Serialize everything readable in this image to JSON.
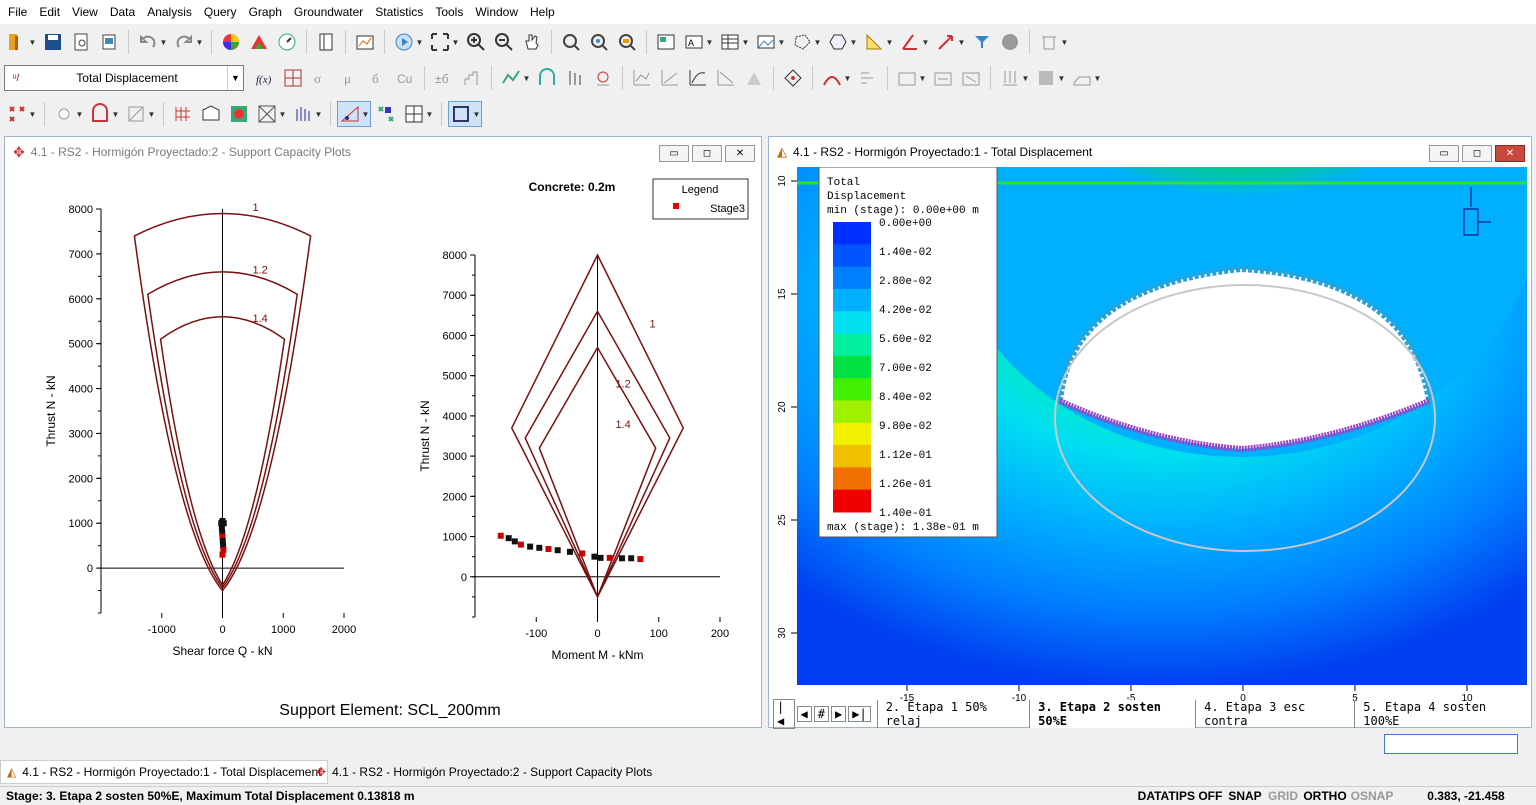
{
  "menu": [
    "File",
    "Edit",
    "View",
    "Data",
    "Analysis",
    "Query",
    "Graph",
    "Groundwater",
    "Statistics",
    "Tools",
    "Window",
    "Help"
  ],
  "toolbar": {
    "contour_selector": "Total Displacement"
  },
  "left_window": {
    "title": "4.1 - RS2 - Hormigón Proyectado:2 - Support Capacity Plots",
    "concrete_label": "Concrete: 0.2m",
    "legend_title": "Legend",
    "legend_item": "Stage3",
    "support_element": "Support Element: SCL_200mm",
    "chart_data": [
      {
        "type": "scatter",
        "xlabel": "Shear force Q - kN",
        "ylabel": "Thrust N - kN",
        "xlim": [
          -2000,
          2000
        ],
        "ylim": [
          -1000,
          8000
        ],
        "x_ticks": [
          "-1000",
          "0",
          "1000",
          "2000"
        ],
        "y_ticks": [
          "8000",
          "7000",
          "6000",
          "5000",
          "4000",
          "3000",
          "2000",
          "1000",
          "0"
        ],
        "envelope_labels": [
          "1",
          "1.2",
          "1.4"
        ],
        "series": [
          {
            "name": "Stage3",
            "x": [
              -15,
              -10,
              -5,
              0,
              5,
              10,
              15,
              -20,
              20,
              0,
              0
            ],
            "y": [
              1000,
              900,
              800,
              700,
              600,
              500,
              400,
              1000,
              1000,
              300,
              1050
            ]
          }
        ]
      },
      {
        "type": "scatter",
        "xlabel": "Moment M - kNm",
        "ylabel": "Thrust N - kN",
        "xlim": [
          -200,
          200
        ],
        "ylim": [
          -1000,
          8000
        ],
        "x_ticks": [
          "-100",
          "0",
          "100",
          "200"
        ],
        "y_ticks": [
          "8000",
          "7000",
          "6000",
          "5000",
          "4000",
          "3000",
          "2000",
          "1000",
          "0"
        ],
        "envelope_labels": [
          "1",
          "1.2",
          "1.4"
        ],
        "series": [
          {
            "name": "Stage3",
            "x": [
              -158,
              -145,
              -135,
              -125,
              -110,
              -95,
              -80,
              -65,
              -45,
              -25,
              -5,
              5,
              20,
              40,
              55,
              70
            ],
            "y": [
              1020,
              960,
              880,
              800,
              750,
              720,
              690,
              660,
              620,
              580,
              500,
              470,
              470,
              460,
              460,
              440
            ]
          }
        ]
      }
    ]
  },
  "right_window": {
    "title": "4.1 - RS2 - Hormigón Proyectado:1 - Total Displacement",
    "legend": {
      "title1": "Total",
      "title2": "Displacement",
      "min_label": "min (stage): 0.00e+00 m",
      "max_label": "max (stage): 1.38e-01 m",
      "levels": [
        "0.00e+00",
        "1.40e-02",
        "2.80e-02",
        "4.20e-02",
        "5.60e-02",
        "7.00e-02",
        "8.40e-02",
        "9.80e-02",
        "1.12e-01",
        "1.26e-01",
        "1.40e-01"
      ],
      "colors": [
        "#0030ff",
        "#0055ff",
        "#0080ff",
        "#00b0ff",
        "#00e0f0",
        "#00f0a0",
        "#00e040",
        "#40f000",
        "#a0f000",
        "#f0f000",
        "#f0c000",
        "#f07000",
        "#f00000"
      ]
    },
    "y_axis_labels": [
      "10",
      "15",
      "20",
      "25",
      "30"
    ],
    "x_axis_labels": [
      "-15",
      "-10",
      "-5",
      "0",
      "5",
      "10"
    ],
    "stage_tabs": [
      "2. Etapa 1 50% relaj",
      "3. Etapa 2 sosten 50%E",
      "4. Etapa 3 esc contra",
      "5. Etapa 4 sosten 100%E"
    ]
  },
  "taskbar": {
    "item1": "4.1 - RS2 - Hormigón Proyectado:1 - Total Displacement",
    "item2": "4.1 - RS2 - Hormigón Proyectado:2 - Support Capacity Plots"
  },
  "status": {
    "stage": "Stage: 3. Etapa 2 sosten 50%E, Maximum Total Displacement 0.13818 m",
    "datatips": "DATATIPS OFF",
    "snap": "SNAP",
    "grid": "GRID",
    "ortho": "ORTHO",
    "osnap": "OSNAP",
    "coords": "0.383,  -21.458"
  }
}
